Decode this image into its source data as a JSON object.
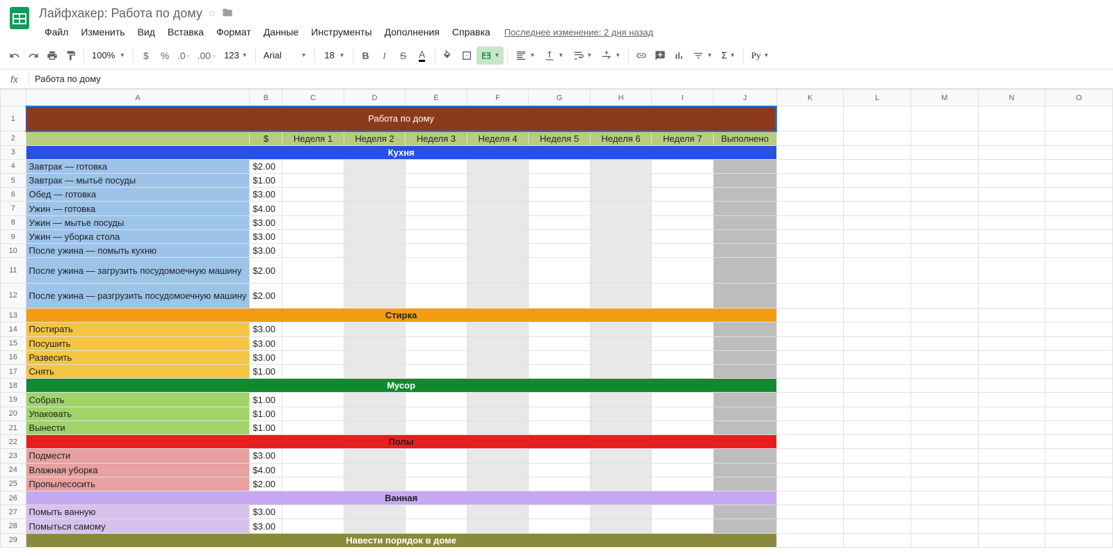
{
  "doc": {
    "title": "Лайфхакер: Работа по дому",
    "last_edit": "Последнее изменение: 2 дня назад"
  },
  "menu": {
    "file": "Файл",
    "edit": "Изменить",
    "view": "Вид",
    "insert": "Вставка",
    "format": "Формат",
    "data": "Данные",
    "tools": "Инструменты",
    "addons": "Дополнения",
    "help": "Справка"
  },
  "toolbar": {
    "zoom": "100%",
    "format_num": "123",
    "font": "Arial",
    "font_size": "18"
  },
  "formula": {
    "fx": "fx",
    "value": "Работа по дому"
  },
  "cols": [
    "A",
    "B",
    "C",
    "D",
    "E",
    "F",
    "G",
    "H",
    "I",
    "J",
    "K",
    "L",
    "M",
    "N",
    "O"
  ],
  "sheet": {
    "title": "Работа по дому",
    "headers": {
      "money": "$",
      "w1": "Неделя 1",
      "w2": "Неделя 2",
      "w3": "Неделя 3",
      "w4": "Неделя 4",
      "w5": "Неделя 5",
      "w6": "Неделя 6",
      "w7": "Неделя 7",
      "done": "Выполнено"
    },
    "categories": {
      "kitchen": "Кухня",
      "laundry": "Стирка",
      "trash": "Мусор",
      "floors": "Полы",
      "bath": "Ванная",
      "house": "Навести порядок в доме"
    },
    "tasks": {
      "kitchen": [
        {
          "name": "Завтрак — готовка",
          "price": "$2.00"
        },
        {
          "name": "Завтрак — мытьё посуды",
          "price": "$1.00"
        },
        {
          "name": "Обед — готовка",
          "price": "$3.00"
        },
        {
          "name": "Ужин — готовка",
          "price": "$4.00"
        },
        {
          "name": "Ужин — мытье посуды",
          "price": "$3.00"
        },
        {
          "name": "Ужин — уборка стола",
          "price": "$3.00"
        },
        {
          "name": "После ужина — помыть кухню",
          "price": "$3.00"
        },
        {
          "name": "После ужина — загрузить посудомоечную машину",
          "price": "$2.00"
        },
        {
          "name": "После ужина — разгрузить посудомоечную машину",
          "price": "$2.00"
        }
      ],
      "laundry": [
        {
          "name": "Постирать",
          "price": "$3.00"
        },
        {
          "name": "Посушить",
          "price": "$3.00"
        },
        {
          "name": "Развесить",
          "price": "$3.00"
        },
        {
          "name": "Снять",
          "price": "$1.00"
        }
      ],
      "trash": [
        {
          "name": "Собрать",
          "price": "$1.00"
        },
        {
          "name": "Упаковать",
          "price": "$1.00"
        },
        {
          "name": "Вынести",
          "price": "$1.00"
        }
      ],
      "floors": [
        {
          "name": "Подмести",
          "price": "$3.00"
        },
        {
          "name": "Влажная уборка",
          "price": "$4.00"
        },
        {
          "name": "Пропылесосить",
          "price": "$2.00"
        }
      ],
      "bath": [
        {
          "name": "Помыть ванную",
          "price": "$3.00"
        },
        {
          "name": "Помыться самому",
          "price": "$3.00"
        }
      ]
    }
  }
}
